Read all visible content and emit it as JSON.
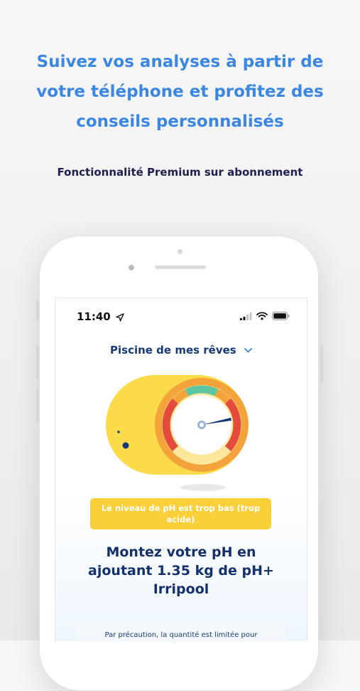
{
  "promo": {
    "headline_line1": "Suivez vos analyses à partir de",
    "headline_line2": "votre téléphone et profitez des",
    "headline_line3": "conseils personnalisés",
    "subheadline": "Fonctionnalité Premium sur abonnement"
  },
  "status_bar": {
    "time": "11:40",
    "icons": [
      "location-arrow-icon",
      "signal-icon",
      "wifi-icon",
      "battery-icon"
    ]
  },
  "pool_selector": {
    "label": "Piscine de mes rêves",
    "icon": "chevron-down-icon"
  },
  "alert": {
    "text": "Le niveau de pH est trop bas (trop acide)"
  },
  "advice": {
    "line1": "Montez votre pH en",
    "line2": "ajoutant 1.35 kg de pH+",
    "line3": "Irripool"
  },
  "note": {
    "text": "Par précaution, la quantité est limitée pour"
  },
  "colors": {
    "headline": "#3a86e0",
    "subheadline": "#1d1f4f",
    "navy": "#163a78",
    "alert_bg": "#f9cf3a",
    "gauge_body": "#f9d63a",
    "gauge_ring": "#f3a33a"
  }
}
